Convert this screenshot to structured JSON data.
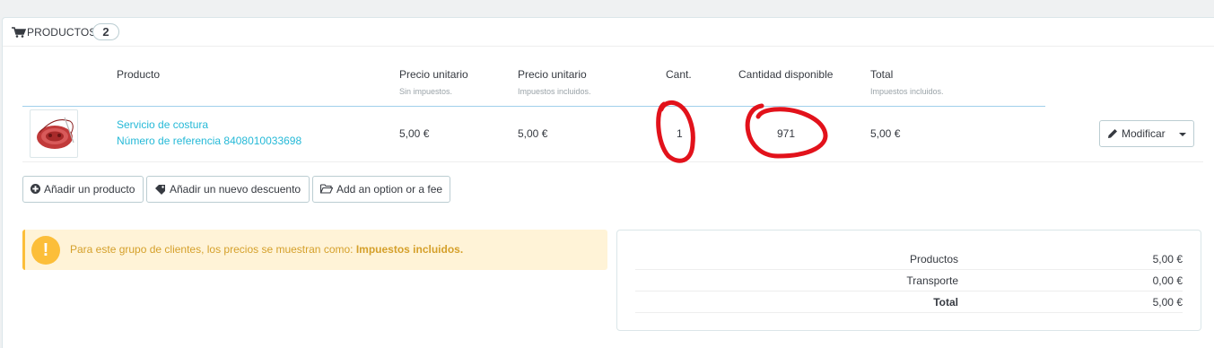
{
  "panel": {
    "title": "PRODUCTOS",
    "count": "2",
    "icon": "shopping-cart-icon"
  },
  "table": {
    "headers": [
      {
        "label": "Producto",
        "sub": ""
      },
      {
        "label": "Precio unitario",
        "sub": "Sin impuestos."
      },
      {
        "label": "Precio unitario",
        "sub": "Impuestos incluidos."
      },
      {
        "label": "Cant.",
        "sub": ""
      },
      {
        "label": "Cantidad disponible",
        "sub": ""
      },
      {
        "label": "Total",
        "sub": "Impuestos incluidos."
      }
    ],
    "rows": [
      {
        "name": "Servicio de costura",
        "reference": "Número de referencia 8408010033698",
        "price_excl": "5,00 €",
        "price_incl": "5,00 €",
        "qty": "1",
        "available": "971",
        "total": "5,00 €",
        "edit_label": "Modificar"
      }
    ]
  },
  "actions": {
    "add_product": "Añadir un producto",
    "add_discount": "Añadir un nuevo descuento",
    "add_option": "Add an option or a fee"
  },
  "alert": {
    "text": "Para este grupo de clientes, los precios se muestran como: ",
    "emphasis": "Impuestos incluidos."
  },
  "summary": {
    "rows": [
      {
        "label": "Productos",
        "value": "5,00 €"
      },
      {
        "label": "Transporte",
        "value": "0,00 €"
      },
      {
        "label": "Total",
        "value": "5,00 €"
      }
    ]
  },
  "colors": {
    "link": "#25b9d7",
    "annotation": "#e2121b",
    "warning": "#fcbe39"
  }
}
